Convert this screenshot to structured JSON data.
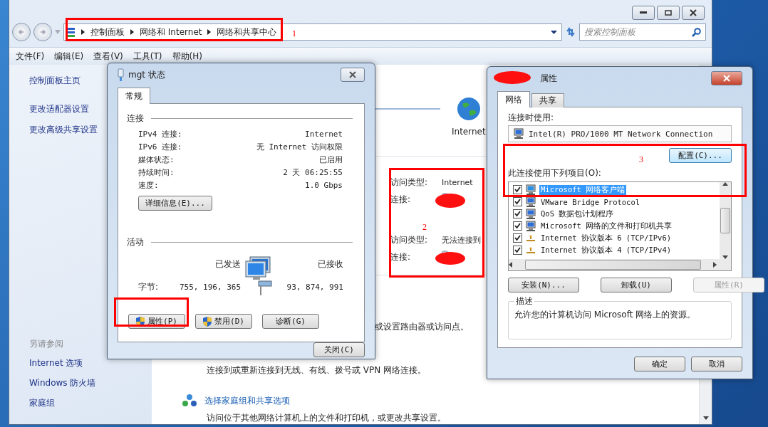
{
  "address_bar": {
    "breadcrumbs": [
      "控制面板",
      "网络和 Internet",
      "网络和共享中心"
    ],
    "search": {
      "placeholder": "搜索控制面板"
    }
  },
  "menu": [
    "文件(F)",
    "编辑(E)",
    "查看(V)",
    "工具(T)",
    "帮助(H)"
  ],
  "sidebar": {
    "links": [
      "控制面板主页",
      "更改适配器设置",
      "更改高级共享设置"
    ],
    "see_also_title": "另请参阅",
    "see_also": [
      "Internet 选项",
      "Windows 防火墙",
      "家庭组"
    ]
  },
  "content": {
    "map_label": "Internet",
    "networks": [
      {
        "access_label": "访问类型:",
        "access_value": "Internet",
        "connection_label": "连接:"
      },
      {
        "access_label": "访问类型:",
        "access_value": "无法连接到",
        "connection_label": "连接:"
      }
    ],
    "tasks": [
      {
        "kind": "text",
        "text": "或设置路由器或访问点。"
      },
      {
        "kind": "text",
        "text": "连接到或重新连接到无线、有线、拨号或 VPN 网络连接。"
      },
      {
        "kind": "link",
        "text": "选择家庭组和共享选项"
      },
      {
        "kind": "text",
        "text": "访问位于其他网络计算机上的文件和打印机，或更改共享设置。"
      }
    ]
  },
  "status_dialog": {
    "title": "mgt 状态",
    "tabs": [
      {
        "label": "常规",
        "selected": true
      }
    ],
    "connection_title": "连接",
    "rows": [
      {
        "label": "IPv4 连接:",
        "value": "Internet"
      },
      {
        "label": "IPv6 连接:",
        "value": "无 Internet 访问权限"
      },
      {
        "label": "媒体状态:",
        "value": "已启用"
      },
      {
        "label": "持续时间:",
        "value": "2 天 06:25:55"
      },
      {
        "label": "速度:",
        "value": "1.0 Gbps"
      }
    ],
    "details_button": "详细信息(E)...",
    "activity_title": "活动",
    "sent_label": "已发送",
    "received_label": "已接收",
    "bytes_label": "字节:",
    "sent": "755, 196, 365",
    "received": "93, 874, 991",
    "buttons": [
      {
        "label": "属性(P)",
        "shield": true
      },
      {
        "label": "禁用(D)",
        "shield": true
      },
      {
        "label": "诊断(G)",
        "shield": false
      }
    ],
    "close_button": "关闭(C)"
  },
  "properties_dialog": {
    "title": "属性",
    "tabs": [
      {
        "label": "网络",
        "selected": true
      },
      {
        "label": "共享",
        "selected": false
      }
    ],
    "connect_using_label": "连接时使用:",
    "adapter": "Intel(R) PRO/1000 MT Network Connection",
    "configure_button": "配置(C)...",
    "items_label": "此连接使用下列项目(O):",
    "items": [
      {
        "kind": "client",
        "label": "Microsoft 网络客户端",
        "checked": true,
        "selected": true
      },
      {
        "kind": "service",
        "label": "VMware Bridge Protocol",
        "checked": true,
        "selected": false
      },
      {
        "kind": "service",
        "label": "QoS 数据包计划程序",
        "checked": true,
        "selected": false
      },
      {
        "kind": "service",
        "label": "Microsoft 网络的文件和打印机共享",
        "checked": true,
        "selected": false
      },
      {
        "kind": "protocol",
        "label": "Internet 协议版本 6 (TCP/IPv6)",
        "checked": true,
        "selected": false
      },
      {
        "kind": "protocol",
        "label": "Internet 协议版本 4 (TCP/IPv4)",
        "checked": true,
        "selected": false
      }
    ],
    "buttons": [
      {
        "label": "安装(N)...",
        "disabled": false
      },
      {
        "label": "卸载(U)",
        "disabled": false
      },
      {
        "label": "属性(R)",
        "disabled": true
      }
    ],
    "description_title": "描述",
    "description": "允许您的计算机访问 Microsoft 网络上的资源。",
    "ok_button": "确定",
    "cancel_button": "取消"
  },
  "annotations": [
    {
      "label": "1"
    },
    {
      "label": "2"
    },
    {
      "label": "3"
    }
  ]
}
